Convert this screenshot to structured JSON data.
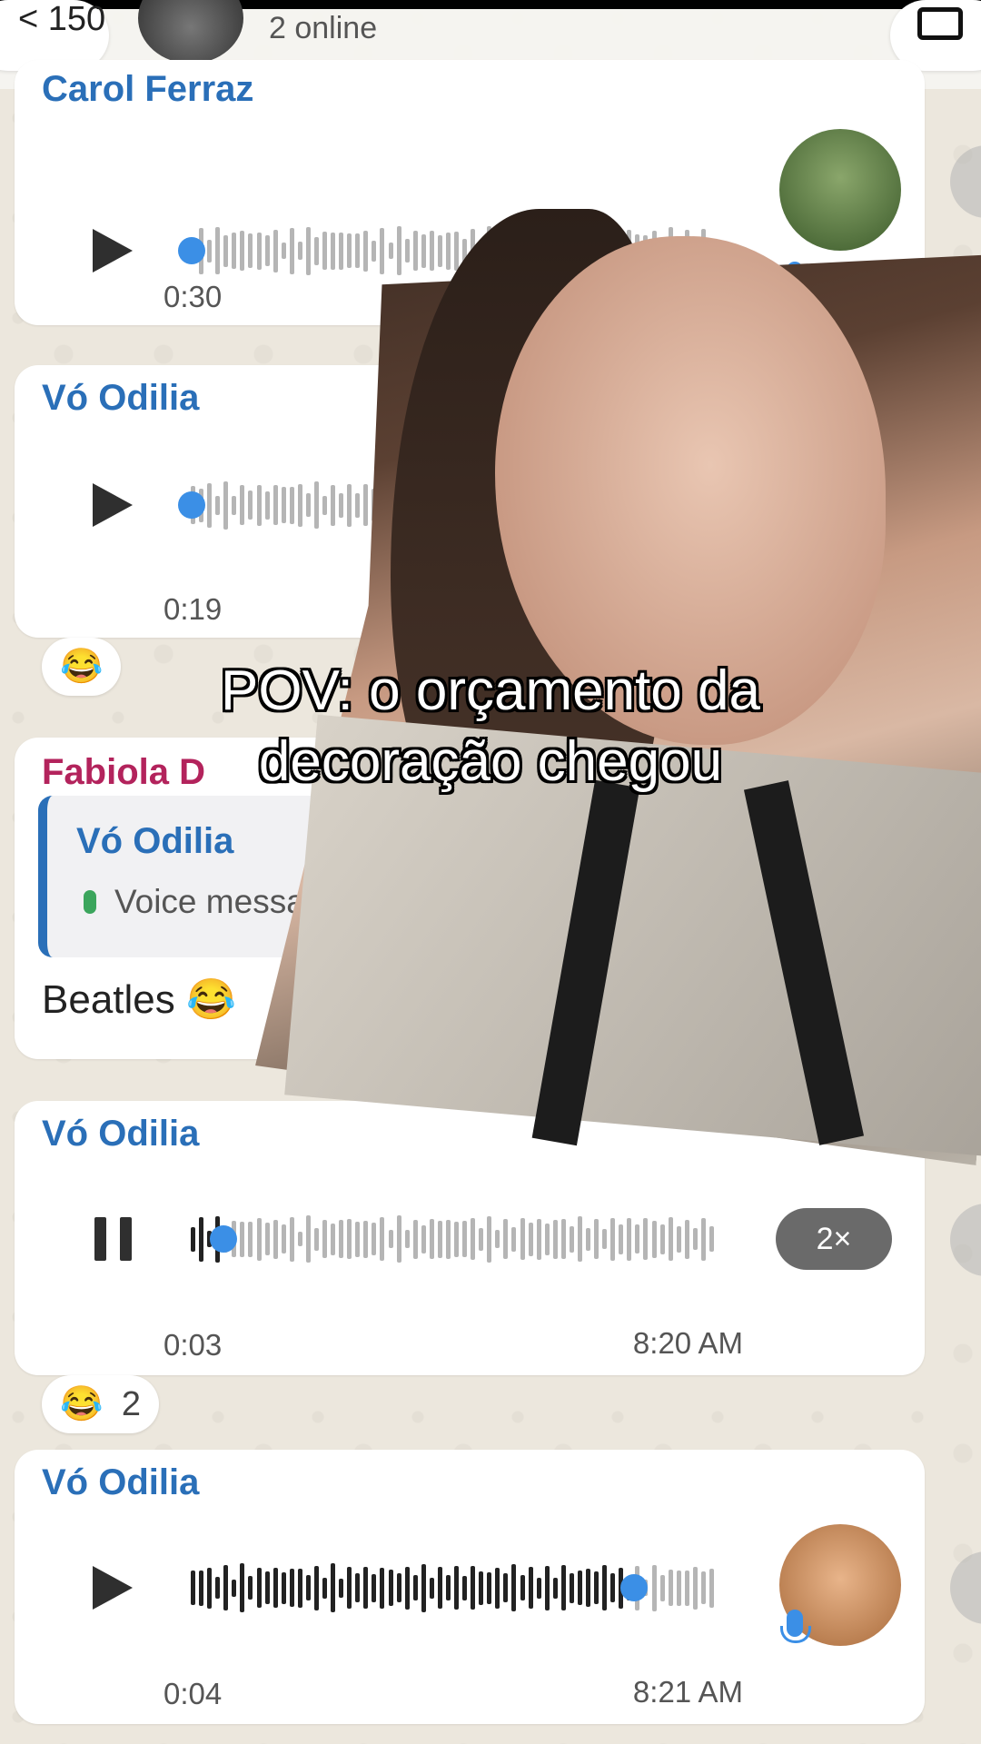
{
  "header": {
    "back_label": "< 150",
    "status": "2 online"
  },
  "messages": [
    {
      "sender": "Carol Ferraz",
      "duration": "0:30",
      "state": "play",
      "progress": 0.0,
      "avatar_color": "#4d6b3a"
    },
    {
      "sender": "Vó Odilia",
      "duration": "0:19",
      "state": "play",
      "progress": 0.0,
      "reaction": "😂"
    },
    {
      "sender": "Fabiola D",
      "reply_name": "Vó Odilia",
      "reply_text": "Voice messa",
      "text": "Beatles 😂"
    },
    {
      "sender": "Vó Odilia",
      "duration": "0:03",
      "time": "8:20 AM",
      "state": "pause",
      "speed": "2×",
      "progress": 0.06,
      "reaction": "😂",
      "reaction_count": "2"
    },
    {
      "sender": "Vó Odilia",
      "duration": "0:04",
      "time": "8:21 AM",
      "state": "play",
      "progress": 0.84,
      "avatar_color": "#c9803f"
    }
  ],
  "overlay": {
    "caption_line1": "POV: o orçamento da",
    "caption_line2": "decoração chegou"
  },
  "colors": {
    "sender_blue": "#2a6fb8",
    "sender_pink": "#b3235c",
    "progress_dot": "#3b8fe6"
  }
}
